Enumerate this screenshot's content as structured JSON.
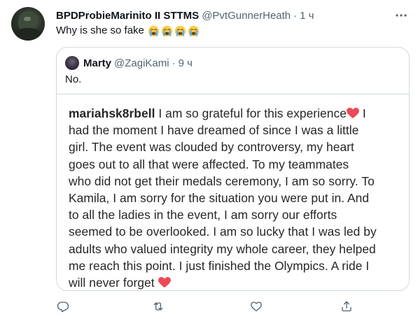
{
  "tweet": {
    "author_name": "BPDProbieMarinito II STTMS",
    "author_handle": "@PvtGunnerHeath",
    "separator": "·",
    "time": "1 ч",
    "text": "Why is she so fake",
    "emojis": [
      "loudly-crying-face",
      "loudly-crying-face",
      "loudly-crying-face",
      "loudly-crying-face"
    ]
  },
  "quoted": {
    "author_name": "Marty",
    "author_handle": "@ZagiKami",
    "separator": "·",
    "time": "9 ч",
    "text": "No.",
    "image": {
      "username": "mariahsk8rbell",
      "lines": [
        " I am so grateful for this experience",
        " I",
        "had the moment I have dreamed of since I was a little",
        "girl. The event was clouded by controversy, my heart",
        "goes out to all that were affected. To my teammates",
        "who did not get their medals ceremony, I am so sorry. To",
        "Kamila, I am sorry for the situation you were put in. And",
        "to all the ladies in the event, I am sorry our efforts",
        "seemed to be overlooked. I am so lucky that I was led by",
        "adults who valued integrity my whole career, they helped",
        "me reach this point. I just finished the Olympics. A ride I",
        "will never forget"
      ],
      "heart_color": "#ed4956"
    }
  },
  "actions": [
    "reply-icon",
    "retweet-icon",
    "like-icon",
    "share-icon"
  ],
  "colors": {
    "secondary_text": "#536471",
    "border": "#cfd9de"
  }
}
